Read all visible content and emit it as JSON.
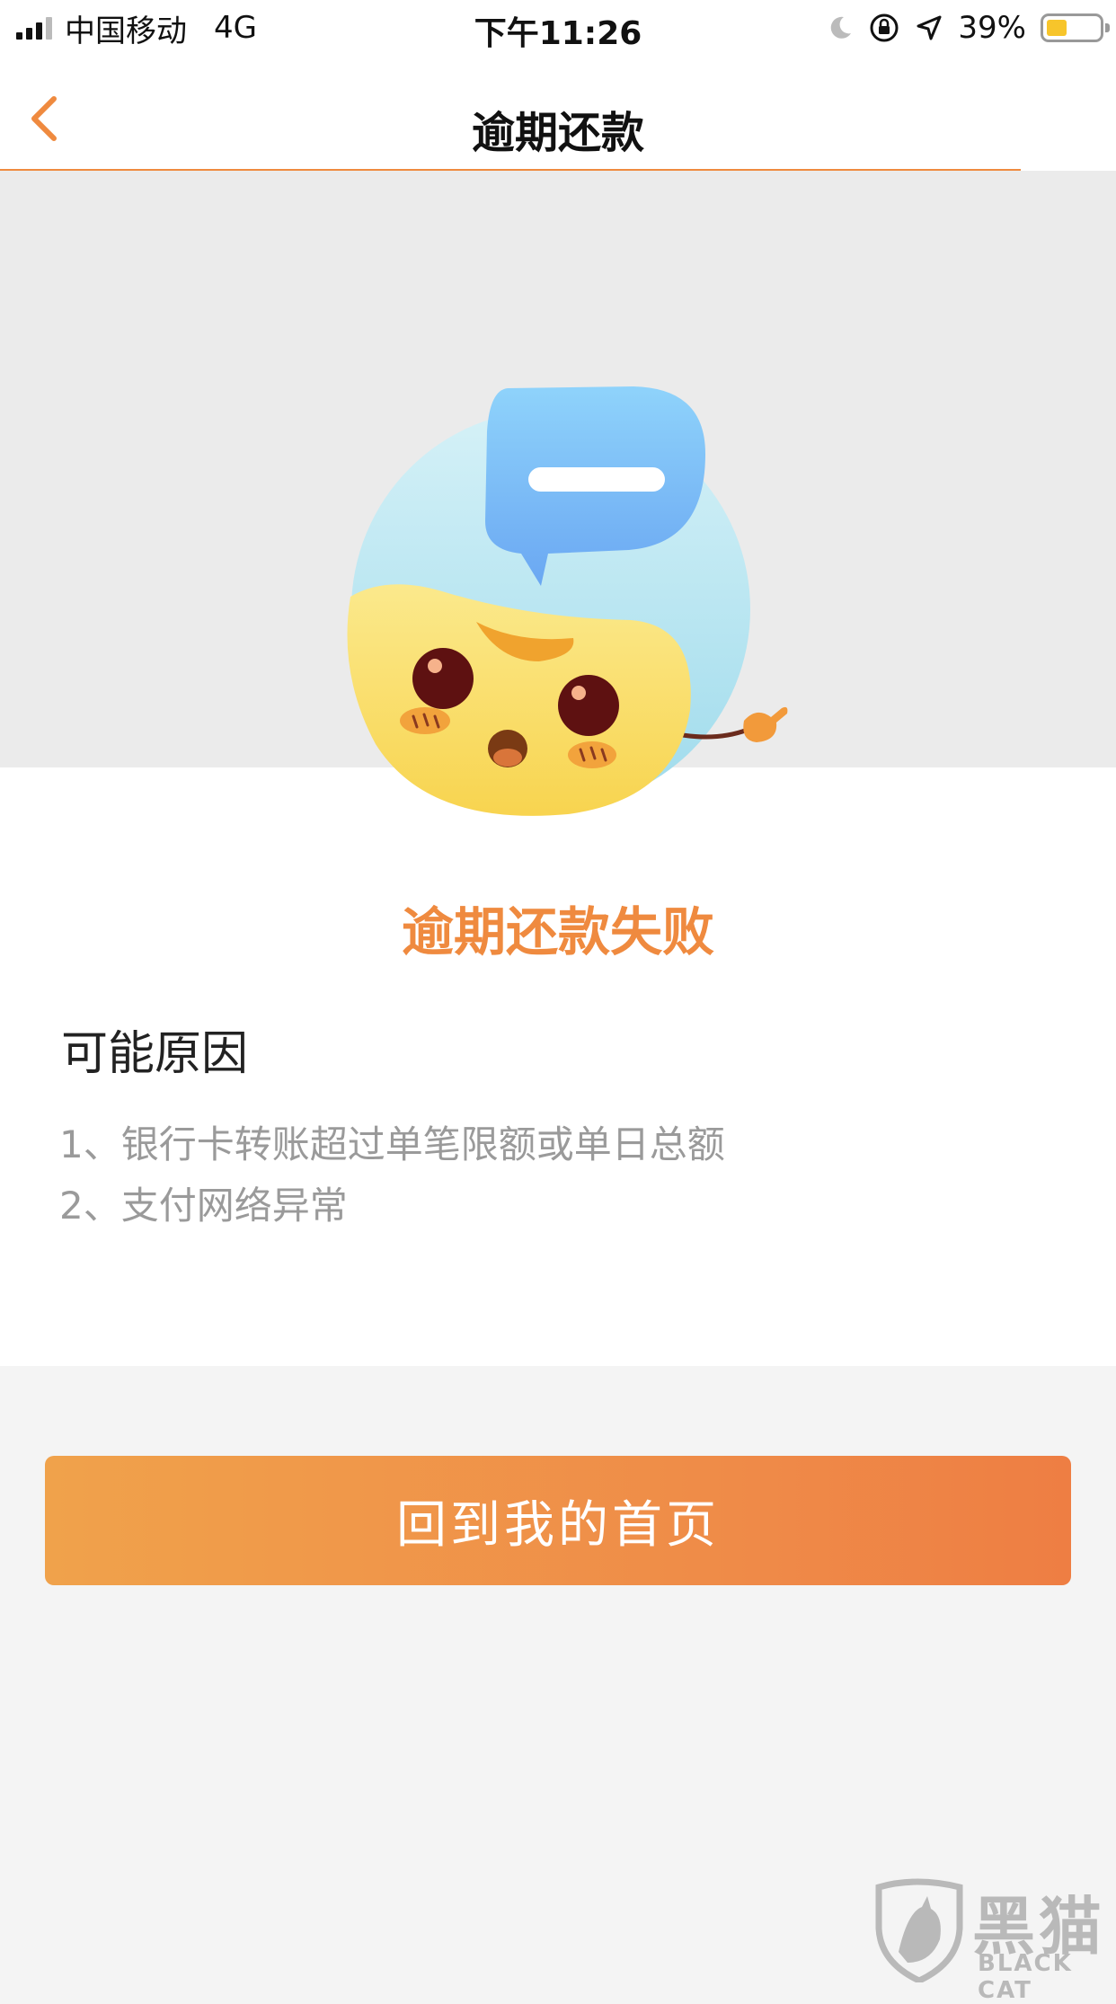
{
  "status_bar": {
    "carrier": "中国移动",
    "network": "4G",
    "time": "下午11:26",
    "battery_percent_text": "39%",
    "battery_level": 0.39,
    "icons": [
      "signal-bars-icon",
      "moon-icon",
      "rotation-lock-icon",
      "location-arrow-icon",
      "battery-icon"
    ]
  },
  "nav": {
    "title": "逾期还款",
    "back_icon": "chevron-left-icon"
  },
  "result": {
    "title": "逾期还款失败",
    "illustration": "mascot-with-speech-bubble"
  },
  "reasons": {
    "heading": "可能原因",
    "items": [
      "1、银行卡转账超过单笔限额或单日总额",
      "2、支付网络异常"
    ]
  },
  "home_button": {
    "label": "回到我的首页"
  },
  "watermark": {
    "cn": "黑猫",
    "en": "BLACK CAT"
  },
  "colors": {
    "accent": "#ef8a3f",
    "button_start": "#f0a24b",
    "button_end": "#ee7e43",
    "hero_bg": "#ebebeb",
    "page_bg": "#f4f4f4"
  }
}
